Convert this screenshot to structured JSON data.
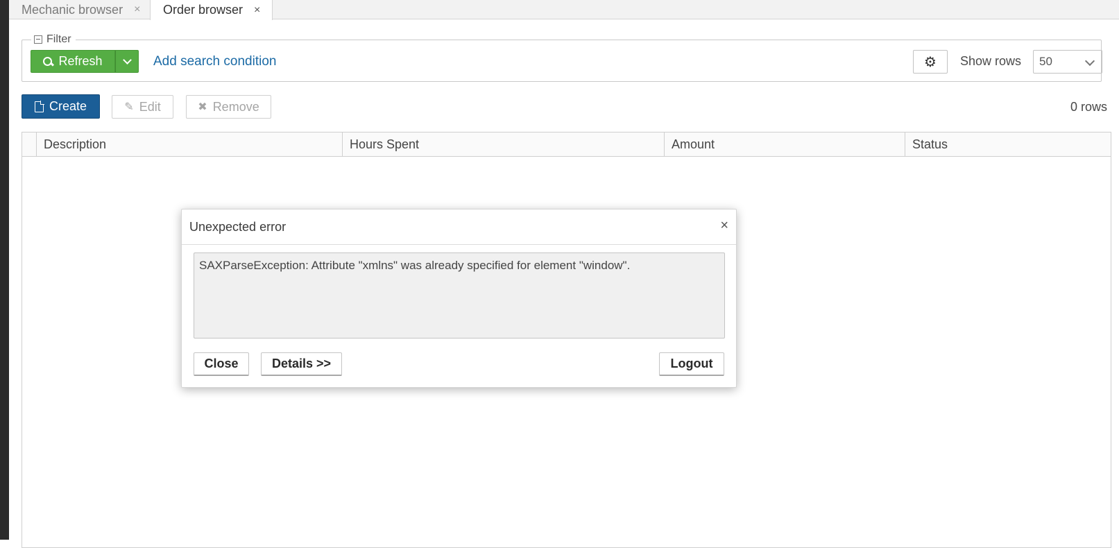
{
  "tabs": [
    {
      "label": "Mechanic browser",
      "close": "×",
      "active": false
    },
    {
      "label": "Order browser",
      "close": "×",
      "active": true
    }
  ],
  "filter": {
    "legend": "Filter",
    "refresh_label": "Refresh",
    "add_condition_label": "Add search condition",
    "show_rows_label": "Show rows",
    "show_rows_value": "50"
  },
  "toolbar": {
    "create_label": "Create",
    "edit_label": "Edit",
    "remove_label": "Remove",
    "row_count": "0 rows"
  },
  "table": {
    "columns": [
      "Description",
      "Hours Spent",
      "Amount",
      "Status"
    ],
    "rows": []
  },
  "dialog": {
    "title": "Unexpected error",
    "close_glyph": "×",
    "message": "SAXParseException: Attribute \"xmlns\" was already specified for element \"window\".",
    "buttons": {
      "close": "Close",
      "details": "Details >>",
      "logout": "Logout"
    }
  },
  "colors": {
    "refresh_green": "#55ad44",
    "create_blue": "#1b5e97",
    "link_blue": "#1b6aa5"
  },
  "icons": {
    "refresh": "search-icon",
    "refresh_dropdown": "chevron-down-icon",
    "settings": "gear-icon",
    "create": "document-icon",
    "edit": "pencil-icon",
    "remove": "x-icon",
    "filter_toggle": "collapse-icon"
  }
}
